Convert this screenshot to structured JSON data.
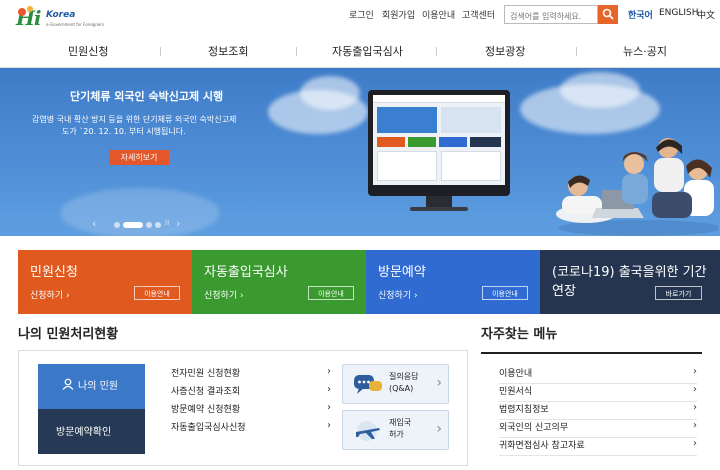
{
  "header": {
    "logo": {
      "main": "Hi",
      "sub": "Korea",
      "tagline": "e-Government for Foreigners"
    },
    "util_links": [
      "로그인",
      "회원가입",
      "이용안내",
      "고객센터"
    ],
    "search": {
      "placeholder": "검색어를 입력하세요."
    },
    "languages": [
      "한국어",
      "ENGLISH",
      "中文"
    ],
    "active_language": "한국어"
  },
  "gnb": {
    "items": [
      "민원신청",
      "정보조회",
      "자동출입국심사",
      "정보광장",
      "뉴스·공지"
    ]
  },
  "banner": {
    "title": "단기체류 외국인 숙박신고제 시행",
    "desc_line1": "감염병 국내 확산 방지 등을 위한 단기체류 외국인 숙박신고제",
    "desc_line2": "도가 `20. 12. 10. 부터 시행됩니다.",
    "button": "자세히보기",
    "pager_prev": "‹",
    "pager_next": "›",
    "pager_pause": "II"
  },
  "tiles": [
    {
      "title": "민원신청",
      "go": "신청하기",
      "info": "이용안내",
      "color": "#e05a1f"
    },
    {
      "title": "자동출입국심사",
      "go": "신청하기",
      "info": "이용안내",
      "color": "#3a9a2f"
    },
    {
      "title": "방문예약",
      "go": "신청하기",
      "info": "이용안내",
      "color": "#2f6bd1"
    },
    {
      "title": "(코로나19) 출국을위한 기간",
      "title2": "연장",
      "info": "바로가기",
      "color": "#25344f"
    }
  ],
  "status": {
    "title": "나의 민원처리현황",
    "my_btn": "나의 민원",
    "visit_btn": "방문예약확인",
    "links": [
      "전자민원 신청현황",
      "사증신청 결과조회",
      "방문예약 신청현황",
      "자동출입국심사신청"
    ],
    "qna": {
      "line1": "질의응답",
      "line2": "(Q&A)"
    },
    "reentry": {
      "line1": "재입국",
      "line2": "허가"
    }
  },
  "favorites": {
    "title": "자주찾는 메뉴",
    "items": [
      "이용안내",
      "민원서식",
      "법령지침정보",
      "외국인의 신고의무",
      "귀화면접심사 참고자료"
    ]
  }
}
